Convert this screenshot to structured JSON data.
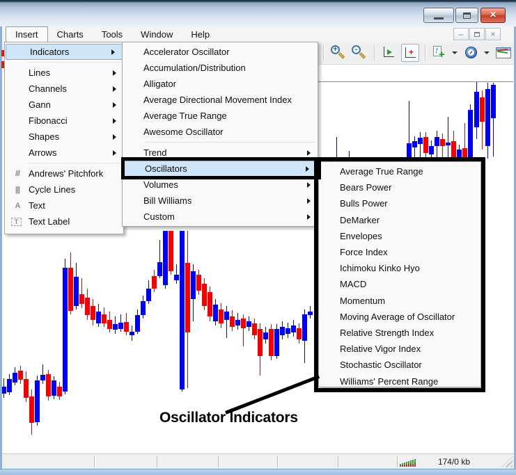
{
  "titlebar": {
    "icons": [
      "minimize-icon",
      "maximize-icon",
      "close-icon"
    ]
  },
  "menubar": {
    "items": [
      "Insert",
      "Charts",
      "Tools",
      "Window",
      "Help"
    ],
    "open_item": "Insert",
    "mdi_icons": [
      "mdi-minimize-icon",
      "mdi-restore-icon",
      "mdi-close-icon"
    ]
  },
  "toolbar": {
    "icons": [
      {
        "name": "line-chart-icon",
        "kind": "curve"
      },
      {
        "kind": "sep"
      },
      {
        "name": "zoom-in-icon",
        "kind": "zoom-in",
        "glyph": "+"
      },
      {
        "name": "zoom-out-icon",
        "kind": "zoom-out",
        "glyph": "-"
      },
      {
        "kind": "sep"
      },
      {
        "name": "auto-scroll-icon",
        "kind": "auto-scroll"
      },
      {
        "name": "chart-shift-icon",
        "kind": "chart-shift",
        "checked": true,
        "glyph": "+"
      },
      {
        "kind": "sep"
      },
      {
        "name": "add-indicator-icon",
        "kind": "add-indicator",
        "glyph": "+"
      },
      {
        "kind": "caret"
      },
      {
        "name": "periods-clock-icon",
        "kind": "clock"
      },
      {
        "kind": "caret"
      },
      {
        "name": "templates-icon",
        "kind": "template"
      },
      {
        "kind": "caret"
      }
    ]
  },
  "insert_menu": {
    "items": [
      {
        "label": "Indicators",
        "submenu": true,
        "selected": true
      },
      {
        "type": "separator"
      },
      {
        "label": "Lines",
        "submenu": true
      },
      {
        "label": "Channels",
        "submenu": true
      },
      {
        "label": "Gann",
        "submenu": true
      },
      {
        "label": "Fibonacci",
        "submenu": true
      },
      {
        "label": "Shapes",
        "submenu": true
      },
      {
        "label": "Arrows",
        "submenu": true
      },
      {
        "type": "separator"
      },
      {
        "label": "Andrews' Pitchfork",
        "icon": "pitchfork-icon",
        "glyph": "///"
      },
      {
        "label": "Cycle Lines",
        "icon": "cycle-lines-icon",
        "glyph": "|||"
      },
      {
        "label": "Text",
        "icon": "text-icon",
        "glyph": "A"
      },
      {
        "label": "Text Label",
        "icon": "text-label-icon",
        "glyph": "T",
        "boxed": true
      }
    ]
  },
  "indicators_menu": {
    "items": [
      {
        "label": "Accelerator Oscillator"
      },
      {
        "label": "Accumulation/Distribution"
      },
      {
        "label": "Alligator"
      },
      {
        "label": "Average Directional Movement Index"
      },
      {
        "label": "Average True Range"
      },
      {
        "label": "Awesome Oscillator"
      },
      {
        "type": "separator"
      },
      {
        "label": "Trend",
        "submenu": true
      },
      {
        "label": "Oscillators",
        "submenu": true,
        "selected": true
      },
      {
        "label": "Volumes",
        "submenu": true
      },
      {
        "label": "Bill Williams",
        "submenu": true
      },
      {
        "label": "Custom",
        "submenu": true
      }
    ]
  },
  "oscillators_menu": {
    "items": [
      {
        "label": "Average True Range"
      },
      {
        "label": "Bears Power"
      },
      {
        "label": "Bulls Power"
      },
      {
        "label": "DeMarker"
      },
      {
        "label": "Envelopes"
      },
      {
        "label": "Force Index"
      },
      {
        "label": "Ichimoku Kinko Hyo"
      },
      {
        "label": "MACD"
      },
      {
        "label": "Momentum"
      },
      {
        "label": "Moving Average of Oscillator"
      },
      {
        "label": "Relative Strength Index"
      },
      {
        "label": "Relative Vigor Index"
      },
      {
        "label": "Stochastic Oscillator"
      },
      {
        "label": "Williams' Percent Range"
      }
    ]
  },
  "annotation": {
    "label": "Oscillator Indicators"
  },
  "statusbar": {
    "connection": "174/0 kb",
    "icons": [
      "connection-bars-icon",
      "resize-grip-icon"
    ]
  },
  "colors": {
    "bull": "#0000f2",
    "bear": "#f20202",
    "highlight": "#cfe5f8",
    "highlight_border": "#7fb0dc",
    "annotation": "#000000"
  },
  "chart_data": {
    "type": "candlestick",
    "description": "Candlestick price chart partially hidden behind open Insert menus",
    "up_color": "#0000f2",
    "down_color": "#f20202",
    "candles": [
      [
        2,
        1,
        556,
        566,
        544,
        572
      ],
      [
        10,
        1,
        545,
        564,
        538,
        568
      ],
      [
        18,
        1,
        536,
        550,
        528,
        554
      ],
      [
        26,
        0,
        533,
        546,
        526,
        552
      ],
      [
        34,
        0,
        545,
        572,
        534,
        578
      ],
      [
        42,
        0,
        570,
        608,
        560,
        625
      ],
      [
        50,
        1,
        547,
        607,
        540,
        612
      ],
      [
        58,
        1,
        539,
        547,
        524,
        552
      ],
      [
        66,
        0,
        538,
        570,
        532,
        576
      ],
      [
        74,
        1,
        547,
        569,
        541,
        574
      ],
      [
        82,
        0,
        556,
        570,
        549,
        575
      ],
      [
        90,
        1,
        385,
        563,
        372,
        567
      ],
      [
        98,
        0,
        385,
        447,
        363,
        452
      ],
      [
        106,
        1,
        398,
        440,
        378,
        445
      ],
      [
        114,
        0,
        423,
        437,
        400,
        443
      ],
      [
        122,
        0,
        428,
        453,
        415,
        460
      ],
      [
        130,
        0,
        440,
        460,
        430,
        468
      ],
      [
        138,
        1,
        448,
        465,
        437,
        470
      ],
      [
        146,
        0,
        452,
        465,
        442,
        470
      ],
      [
        154,
        0,
        460,
        473,
        448,
        478
      ],
      [
        162,
        1,
        466,
        474,
        455,
        480
      ],
      [
        170,
        1,
        464,
        473,
        452,
        477
      ],
      [
        178,
        0,
        463,
        477,
        450,
        482
      ],
      [
        186,
        1,
        477,
        482,
        468,
        490
      ],
      [
        194,
        1,
        453,
        477,
        445,
        480
      ],
      [
        202,
        1,
        433,
        453,
        425,
        458
      ],
      [
        210,
        1,
        415,
        433,
        403,
        437
      ],
      [
        218,
        0,
        397,
        415,
        388,
        420
      ],
      [
        226,
        1,
        377,
        397,
        345,
        400
      ],
      [
        234,
        1,
        332,
        410,
        332,
        415
      ],
      [
        242,
        0,
        332,
        390,
        332,
        395
      ],
      [
        250,
        1,
        395,
        403,
        380,
        408
      ],
      [
        258,
        1,
        332,
        560,
        332,
        563
      ],
      [
        266,
        0,
        378,
        478,
        332,
        558
      ],
      [
        274,
        1,
        390,
        430,
        380,
        462
      ],
      [
        282,
        0,
        395,
        418,
        388,
        424
      ],
      [
        290,
        0,
        408,
        440,
        400,
        446
      ],
      [
        298,
        0,
        420,
        455,
        412,
        462
      ],
      [
        306,
        1,
        438,
        462,
        430,
        468
      ],
      [
        314,
        0,
        445,
        465,
        436,
        472
      ],
      [
        322,
        1,
        448,
        460,
        440,
        486
      ],
      [
        330,
        0,
        455,
        470,
        446,
        476
      ],
      [
        338,
        1,
        460,
        468,
        450,
        474
      ],
      [
        346,
        0,
        458,
        472,
        452,
        498
      ],
      [
        354,
        1,
        462,
        470,
        455,
        476
      ],
      [
        362,
        0,
        465,
        482,
        458,
        488
      ],
      [
        370,
        0,
        473,
        512,
        465,
        540
      ],
      [
        378,
        1,
        478,
        488,
        470,
        494
      ],
      [
        386,
        0,
        473,
        512,
        466,
        518
      ],
      [
        394,
        1,
        473,
        512,
        466,
        516
      ],
      [
        402,
        1,
        470,
        482,
        462,
        488
      ],
      [
        410,
        1,
        472,
        480,
        464,
        486
      ],
      [
        418,
        1,
        468,
        478,
        460,
        484
      ],
      [
        426,
        0,
        472,
        488,
        465,
        494
      ],
      [
        434,
        1,
        452,
        490,
        445,
        522
      ],
      [
        442,
        1,
        448,
        453,
        440,
        458
      ],
      [
        480,
        1,
        230,
        242,
        197,
        242
      ],
      [
        498,
        1,
        232,
        248,
        217,
        248
      ],
      [
        584,
        1,
        206,
        258,
        145,
        258
      ],
      [
        592,
        1,
        203,
        212,
        196,
        238
      ],
      [
        600,
        1,
        198,
        207,
        190,
        238
      ],
      [
        608,
        0,
        197,
        220,
        190,
        243
      ],
      [
        616,
        1,
        210,
        222,
        202,
        238
      ],
      [
        624,
        1,
        197,
        210,
        188,
        238
      ],
      [
        632,
        0,
        200,
        210,
        192,
        243
      ],
      [
        640,
        1,
        205,
        209,
        168,
        238
      ],
      [
        648,
        0,
        203,
        227,
        188,
        248
      ],
      [
        656,
        1,
        215,
        227,
        208,
        248
      ],
      [
        664,
        0,
        213,
        227,
        177,
        248
      ],
      [
        672,
        1,
        158,
        227,
        150,
        252
      ],
      [
        681,
        1,
        132,
        183,
        118,
        200
      ],
      [
        689,
        0,
        140,
        175,
        130,
        215
      ],
      [
        697,
        1,
        128,
        210,
        119,
        228
      ],
      [
        705,
        1,
        122,
        170,
        119,
        225
      ]
    ]
  }
}
